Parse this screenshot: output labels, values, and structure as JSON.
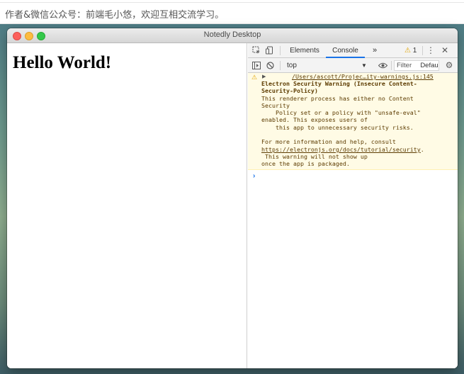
{
  "article": {
    "caption": "作者&微信公众号：前端毛小悠，欢迎互相交流学习。"
  },
  "window": {
    "title": "Notedly Desktop"
  },
  "page": {
    "heading": "Hello World!"
  },
  "devtools": {
    "tabs": [
      "Elements",
      "Console"
    ],
    "active_tab": "Console",
    "more_tabs_glyph": "»",
    "warning_count": "1",
    "context": "top",
    "filter_placeholder": "Filter",
    "log_level": "Defau"
  },
  "console": {
    "warning": {
      "source": "/Users/ascott/Projec…ity-warnings.js:145",
      "title_line1": "Electron Security Warning (Insecure Content-",
      "title_line2": "Security-Policy)",
      "body": [
        "This renderer process has either no Content",
        "Security",
        "    Policy set or a policy with \"unsafe-eval\"",
        "enabled. This exposes users of",
        "    this app to unnecessary security risks.",
        "",
        "For more information and help, consult"
      ],
      "link": "https://electronjs.org/docs/tutorial/security",
      "link_suffix": ".",
      "tail": [
        " This warning will not show up",
        "once the app is packaged."
      ]
    },
    "prompt_glyph": "›"
  },
  "colors": {
    "warning_bg": "#fffbe5",
    "warning_text": "#5c3b00",
    "accent": "#1a73e8",
    "warning_icon": "#e0a300"
  },
  "icons": [
    "inspect-element-icon",
    "device-toggle-icon",
    "kebab-menu-icon",
    "close-icon",
    "sidebar-toggle-icon",
    "clear-console-icon",
    "eye-icon",
    "gear-icon",
    "warning-icon",
    "expand-arrow-icon",
    "console-prompt-icon"
  ]
}
